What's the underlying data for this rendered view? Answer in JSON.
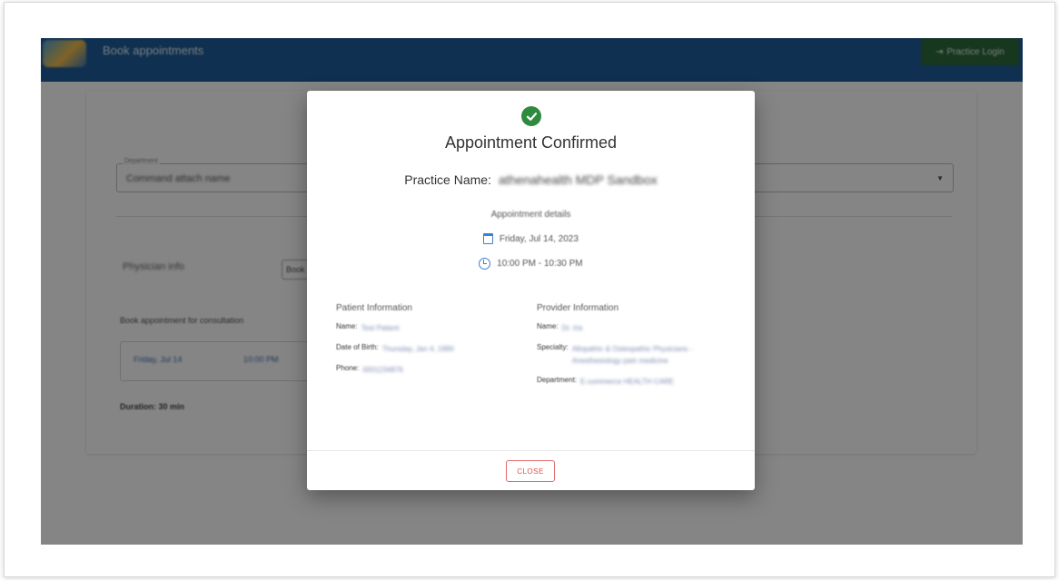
{
  "app": {
    "title": "Book appointments",
    "practice_login_label": "Practice Login"
  },
  "background": {
    "department_field_label": "Department",
    "department_field_value": "Command attach name",
    "physician_label": "Physician info",
    "book_chip_label": "Book",
    "book_for_text": "Book appointment for consultation",
    "slot_date": "Friday, Jul 14",
    "slot_time": "10:00 PM",
    "duration_text": "Duration: 30 min"
  },
  "modal": {
    "title": "Appointment Confirmed",
    "practice_name_label": "Practice Name:",
    "practice_name_value": "athenahealth MDP Sandbox",
    "details_label": "Appointment details",
    "date": "Friday, Jul 14, 2023",
    "time": "10:00 PM - 10:30 PM",
    "patient": {
      "heading": "Patient Information",
      "name_label": "Name:",
      "name_value": "Test Patient",
      "dob_label": "Date of Birth:",
      "dob_value": "Thursday, Jan 4, 1990",
      "phone_label": "Phone:",
      "phone_value": "0001234876"
    },
    "provider": {
      "heading": "Provider Information",
      "name_label": "Name:",
      "name_value": "Dr. Iris",
      "specialty_label": "Specialty:",
      "specialty_value": "Allopathic & Osteopathic Physicians - Anesthesiology pain medicine",
      "department_label": "Department:",
      "department_value": "E-commerce HEALTH CARE"
    },
    "close_label": "CLOSE"
  },
  "colors": {
    "topbar": "#1d5d99",
    "confirm_green": "#2e8b3e",
    "close_red": "#d9534f",
    "icon_blue": "#3b7fd0"
  }
}
